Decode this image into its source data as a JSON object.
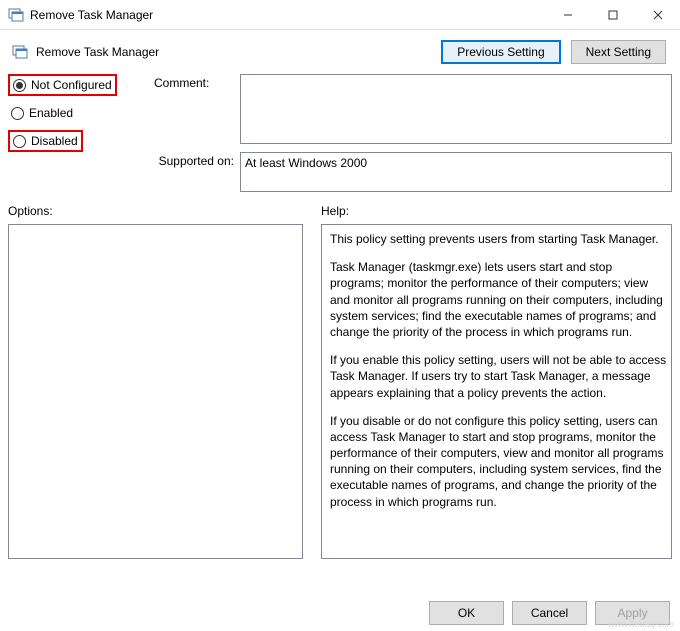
{
  "window": {
    "title": "Remove Task Manager",
    "icon": "policy-icon"
  },
  "header": {
    "title": "Remove Task Manager",
    "prev_button": "Previous Setting",
    "next_button": "Next Setting"
  },
  "state": {
    "options": [
      {
        "label": "Not Configured",
        "checked": true,
        "highlight": true
      },
      {
        "label": "Enabled",
        "checked": false,
        "highlight": false
      },
      {
        "label": "Disabled",
        "checked": false,
        "highlight": true
      }
    ],
    "comment_label": "Comment:",
    "comment_value": "",
    "supported_label": "Supported on:",
    "supported_value": "At least Windows 2000"
  },
  "sections": {
    "options_label": "Options:",
    "help_label": "Help:"
  },
  "help": {
    "p1": "This policy setting prevents users from starting Task Manager.",
    "p2": "Task Manager (taskmgr.exe) lets users start and stop programs; monitor the performance of their computers; view and monitor all programs running on their computers, including system services; find the executable names of programs; and change the priority of the process in which programs run.",
    "p3": "If you enable this policy setting, users will not be able to access Task Manager. If users try to start Task Manager, a message appears explaining that a policy prevents the action.",
    "p4": "If you disable or do not configure this policy setting, users can access Task Manager to  start and stop programs, monitor the performance of their computers, view and monitor all programs running on their computers, including system services, find the executable names of programs, and change the priority of the process in which programs run."
  },
  "footer": {
    "ok": "OK",
    "cancel": "Cancel",
    "apply": "Apply"
  },
  "watermark": "www.deuaq.com"
}
